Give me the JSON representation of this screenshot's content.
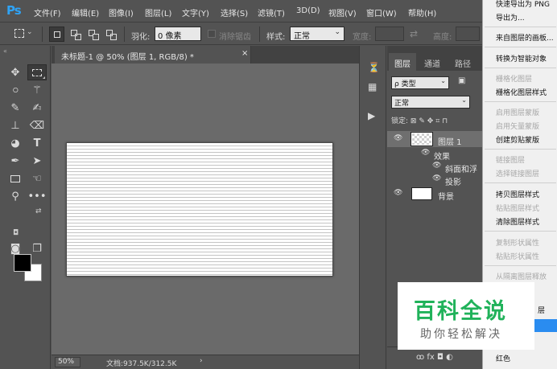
{
  "menubar": {
    "logo": "Ps",
    "items": [
      "文件(F)",
      "编辑(E)",
      "图像(I)",
      "图层(L)",
      "文字(Y)",
      "选择(S)",
      "滤镜(T)",
      "3D(D)",
      "视图(V)",
      "窗口(W)",
      "帮助(H)"
    ]
  },
  "options": {
    "feather_label": "羽化:",
    "feather_value": "0 像素",
    "antialias_label": "消除锯齿",
    "style_label": "样式:",
    "style_value": "正常",
    "width_label": "宽度:",
    "height_label": "高度:"
  },
  "document": {
    "tab_title": "未标题-1 @ 50% (图层 1, RGB/8) *",
    "close": "×",
    "zoom": "50%",
    "doc_size": "文档:937.5K/312.5K",
    "status_arrow": "›"
  },
  "layers_panel": {
    "tabs": [
      "图层",
      "通道",
      "路径"
    ],
    "kind_filter": "ρ 类型",
    "blend_mode": "正常",
    "lock_label": "锁定:",
    "layers": [
      {
        "name": "图层 1",
        "selected": true
      },
      {
        "name": "效果",
        "selected": false
      },
      {
        "name": "斜面和浮",
        "selected": false
      },
      {
        "name": "投影",
        "selected": false
      },
      {
        "name": "背景",
        "selected": false
      }
    ],
    "bottom_icons": "ꝏ fx ◘ ◐"
  },
  "context_menu": {
    "items": [
      {
        "label": "快速导出为 PNG",
        "disabled": false
      },
      {
        "label": "导出为...",
        "disabled": false
      },
      {
        "label": "来自图层的画板...",
        "disabled": false
      },
      {
        "label": "转换为智能对象",
        "disabled": false
      },
      {
        "label": "栅格化图层",
        "disabled": true
      },
      {
        "label": "栅格化图层样式",
        "disabled": false
      },
      {
        "label": "启用图层蒙版",
        "disabled": true
      },
      {
        "label": "启用矢量蒙版",
        "disabled": true
      },
      {
        "label": "创建剪贴蒙版",
        "disabled": false
      },
      {
        "label": "链接图层",
        "disabled": true
      },
      {
        "label": "选择链接图层",
        "disabled": true
      },
      {
        "label": "拷贝图层样式",
        "disabled": false
      },
      {
        "label": "粘贴图层样式",
        "disabled": true
      },
      {
        "label": "清除图层样式",
        "disabled": false
      },
      {
        "label": "复制形状属性",
        "disabled": true
      },
      {
        "label": "粘贴形状属性",
        "disabled": true
      },
      {
        "label": "从隔离图层释放",
        "disabled": true
      },
      {
        "label": "层",
        "disabled": false
      },
      {
        "label": "红色",
        "disabled": false
      }
    ]
  },
  "watermark": {
    "title": "百科全说",
    "subtitle": "助你轻松解决"
  },
  "colors": {
    "accent": "#2fa3f6",
    "highlight": "#2a8cf0",
    "watermark_green": "#20b25a",
    "foreground": "#000000",
    "background": "#ffffff"
  }
}
